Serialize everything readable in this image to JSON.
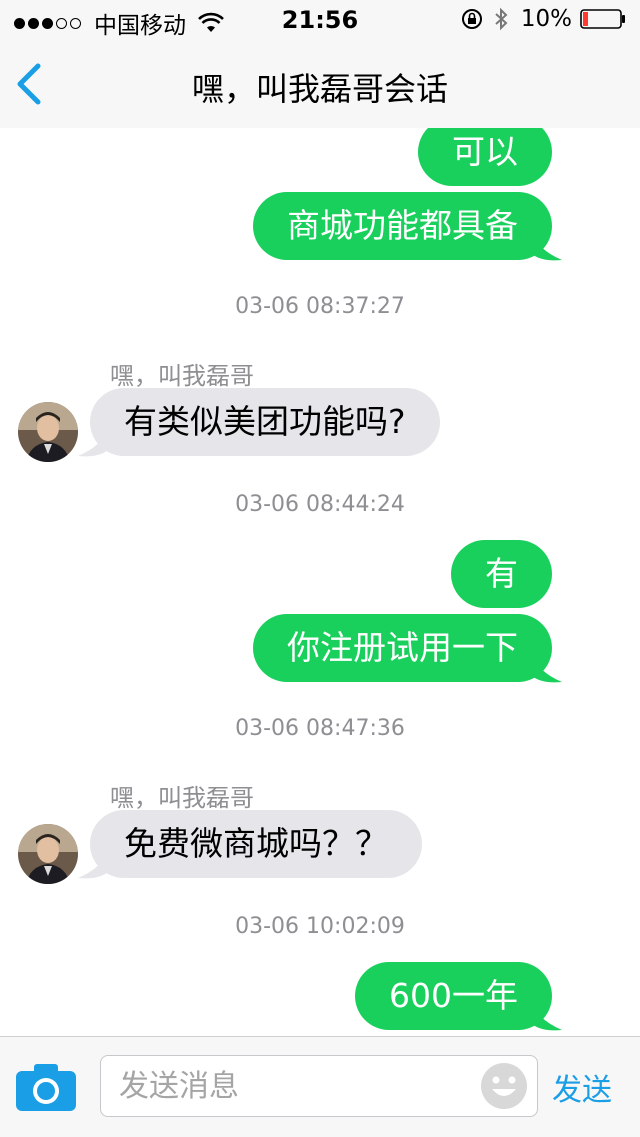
{
  "status_bar": {
    "carrier": "中国移动",
    "time": "21:56",
    "battery_percent": "10%",
    "signal_dots_filled": 3,
    "signal_dots_total": 5
  },
  "nav": {
    "title": "嘿，叫我磊哥会话",
    "back_icon": "chevron-left-icon"
  },
  "messages": [
    {
      "type": "outgoing",
      "text": "可以"
    },
    {
      "type": "outgoing",
      "text": "商城功能都具备"
    },
    {
      "type": "timestamp",
      "text": "03-06 08:37:27"
    },
    {
      "type": "incoming",
      "sender": "嘿，叫我磊哥",
      "text": "有类似美团功能吗?"
    },
    {
      "type": "timestamp",
      "text": "03-06 08:44:24"
    },
    {
      "type": "outgoing",
      "text": "有"
    },
    {
      "type": "outgoing",
      "text": "你注册试用一下"
    },
    {
      "type": "timestamp",
      "text": "03-06 08:47:36"
    },
    {
      "type": "incoming",
      "sender": "嘿，叫我磊哥",
      "text": "免费微商城吗？？"
    },
    {
      "type": "timestamp",
      "text": "03-06 10:02:09"
    },
    {
      "type": "outgoing",
      "text": "600一年"
    }
  ],
  "input_bar": {
    "placeholder": "发送消息",
    "send_label": "发送"
  },
  "colors": {
    "outgoing_bubble": "#1ad05d",
    "incoming_bubble": "#e5e5ea",
    "accent": "#1a9ee6",
    "battery_low": "#ff3b30"
  }
}
